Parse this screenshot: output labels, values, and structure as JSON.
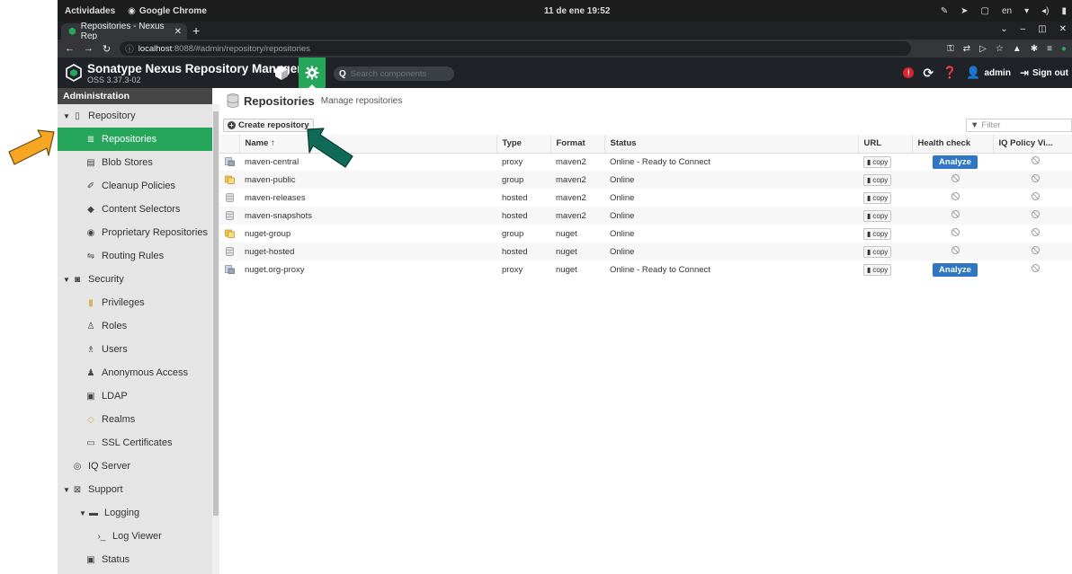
{
  "os": {
    "activities": "Actividades",
    "app_name": "Google Chrome",
    "clock": "11 de ene 19:52",
    "lang": "en"
  },
  "browser": {
    "tab_title": "Repositories - Nexus Rep",
    "url_host": "localhost",
    "url_rest": ":8088/#admin/repository/repositories"
  },
  "app": {
    "title": "Sonatype Nexus Repository Manager",
    "version": "OSS 3.37.3-02",
    "search_placeholder": "Search components",
    "user": "admin",
    "sign_out": "Sign out",
    "alert_count": "!"
  },
  "sidebar": {
    "header": "Administration",
    "items": [
      {
        "label": "Repository",
        "level": 0,
        "tri": "▼",
        "icon": "database-icon"
      },
      {
        "label": "Repositories",
        "level": 1,
        "icon": "list-icon",
        "selected": true
      },
      {
        "label": "Blob Stores",
        "level": 1,
        "icon": "server-icon"
      },
      {
        "label": "Cleanup Policies",
        "level": 1,
        "icon": "broom-icon"
      },
      {
        "label": "Content Selectors",
        "level": 1,
        "icon": "layers-icon"
      },
      {
        "label": "Proprietary Repositories",
        "level": 1,
        "icon": "eye-icon"
      },
      {
        "label": "Routing Rules",
        "level": 1,
        "icon": "signpost-icon"
      },
      {
        "label": "Security",
        "level": 0,
        "tri": "▼",
        "icon": "shield-icon"
      },
      {
        "label": "Privileges",
        "level": 1,
        "icon": "medal-icon"
      },
      {
        "label": "Roles",
        "level": 1,
        "icon": "user-tie-icon"
      },
      {
        "label": "Users",
        "level": 1,
        "icon": "users-icon"
      },
      {
        "label": "Anonymous Access",
        "level": 1,
        "icon": "user-icon"
      },
      {
        "label": "LDAP",
        "level": 1,
        "icon": "book-icon"
      },
      {
        "label": "Realms",
        "level": 1,
        "icon": "shield-small-icon"
      },
      {
        "label": "SSL Certificates",
        "level": 1,
        "icon": "certificate-icon"
      },
      {
        "label": "IQ Server",
        "level": 0,
        "icon": "iq-icon"
      },
      {
        "label": "Support",
        "level": 0,
        "tri": "▼",
        "icon": "lifebuoy-icon"
      },
      {
        "label": "Logging",
        "level": 1,
        "tri": "▼",
        "icon": "scroll-icon"
      },
      {
        "label": "Log Viewer",
        "level": 2,
        "icon": "terminal-icon"
      },
      {
        "label": "Status",
        "level": 1,
        "icon": "medkit-icon"
      }
    ]
  },
  "page": {
    "title": "Repositories",
    "subtitle": "Manage repositories",
    "create_button": "Create repository",
    "filter_placeholder": "Filter"
  },
  "table": {
    "columns": [
      "Name ↑",
      "Type",
      "Format",
      "Status",
      "URL",
      "Health check",
      "IQ Policy Vi..."
    ],
    "copy_label": "copy",
    "analyze_label": "Analyze",
    "rows": [
      {
        "name": "maven-central",
        "type": "proxy",
        "format": "maven2",
        "status": "Online - Ready to Connect",
        "health": "analyze",
        "icon": "proxy"
      },
      {
        "name": "maven-public",
        "type": "group",
        "format": "maven2",
        "status": "Online",
        "health": "none",
        "icon": "group"
      },
      {
        "name": "maven-releases",
        "type": "hosted",
        "format": "maven2",
        "status": "Online",
        "health": "none",
        "icon": "hosted"
      },
      {
        "name": "maven-snapshots",
        "type": "hosted",
        "format": "maven2",
        "status": "Online",
        "health": "none",
        "icon": "hosted"
      },
      {
        "name": "nuget-group",
        "type": "group",
        "format": "nuget",
        "status": "Online",
        "health": "none",
        "icon": "group"
      },
      {
        "name": "nuget-hosted",
        "type": "hosted",
        "format": "nuget",
        "status": "Online",
        "health": "none",
        "icon": "hosted"
      },
      {
        "name": "nuget.org-proxy",
        "type": "proxy",
        "format": "nuget",
        "status": "Online - Ready to Connect",
        "health": "analyze",
        "icon": "proxy"
      }
    ]
  },
  "colors": {
    "accent_green": "#26a65b",
    "header_dark": "#1f2327",
    "analyze_blue": "#2f77c4",
    "arrow_orange": "#f5a623",
    "arrow_teal": "#0e6b58"
  }
}
